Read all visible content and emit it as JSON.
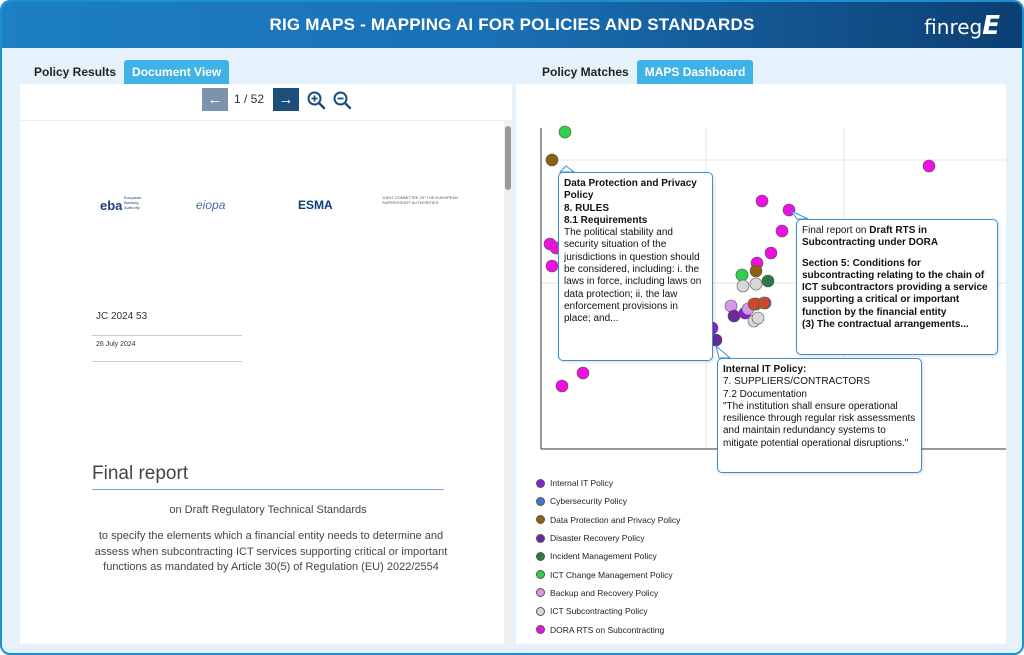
{
  "header": {
    "title": "RIG MAPS - MAPPING AI FOR POLICIES AND STANDARDS",
    "logo_text": "finreg",
    "logo_mark": "E"
  },
  "left_tabs": [
    {
      "label": "Policy Results",
      "active": false
    },
    {
      "label": "Document View",
      "active": true
    }
  ],
  "right_tabs": [
    {
      "label": "Policy Matches",
      "active": false
    },
    {
      "label": "MAPS Dashboard",
      "active": true
    }
  ],
  "doc_viewer": {
    "page_counter": "1 / 52",
    "prev_icon": "←",
    "next_icon": "→",
    "zoom_in_icon": "zoom-in-icon",
    "zoom_out_icon": "zoom-out-icon"
  },
  "document": {
    "logos": {
      "eba": "eba",
      "eba_sub": "European Banking Authority",
      "eiopa": "eiopa",
      "esma": "ESMA",
      "joint": "JOINT COMMITTEE OF THE EUROPEAN SUPERVISORY AUTHORITIES"
    },
    "ref": "JC 2024 53",
    "date": "26 July 2024",
    "title": "Final report",
    "subtitle": "on Draft Regulatory Technical Standards",
    "description": "to specify the elements which a financial entity needs to determine and assess when subcontracting ICT services supporting critical or important functions as mandated by Article 30(5) of Regulation (EU) 2022/2554"
  },
  "chart_data": {
    "type": "scatter",
    "series": [
      {
        "name": "Internal IT Policy",
        "color": "#8a1fd6"
      },
      {
        "name": "Cybersecurity Policy",
        "color": "#3a78d6"
      },
      {
        "name": "Data Protection and Privacy Policy",
        "color": "#8a6212"
      },
      {
        "name": "Disaster Recovery Policy",
        "color": "#6a2a9a"
      },
      {
        "name": "Incident Management Policy",
        "color": "#2a7a4a"
      },
      {
        "name": "ICT Change Management Policy",
        "color": "#2ed24a"
      },
      {
        "name": "Backup and Recovery Policy",
        "color": "#d49ae8"
      },
      {
        "name": "ICT Subcontracting Policy",
        "color": "#d8d8d8"
      },
      {
        "name": "DORA RTS on Subcontracting",
        "color": "#ee10e0"
      }
    ],
    "grid": true
  },
  "callouts": [
    {
      "title": "Data Protection and Privacy Policy",
      "section": "8. RULES",
      "subsection": "8.1 Requirements",
      "text": "The political stability and security situation of the jurisdictions in question should be considered, including: i. the laws in force, including laws on data protection; ii. the law enforcement provisions in place; and..."
    },
    {
      "title_prefix": "Final report on ",
      "title_bold": "Draft RTS in Subcontracting under DORA",
      "section": "Section 5: Conditions for subcontracting relating to the chain of ICT subcontractors providing a service supporting a critical or important function by the financial entity",
      "text": "(3) The contractual arrangements..."
    },
    {
      "title": "Internal IT Policy:",
      "section": "7. SUPPLIERS/CONTRACTORS",
      "subsection": "7.2 Documentation",
      "text": "\"The institution shall ensure operational resilience through regular risk assessments and maintain redundancy systems to mitigate potential operational disruptions.\""
    }
  ]
}
